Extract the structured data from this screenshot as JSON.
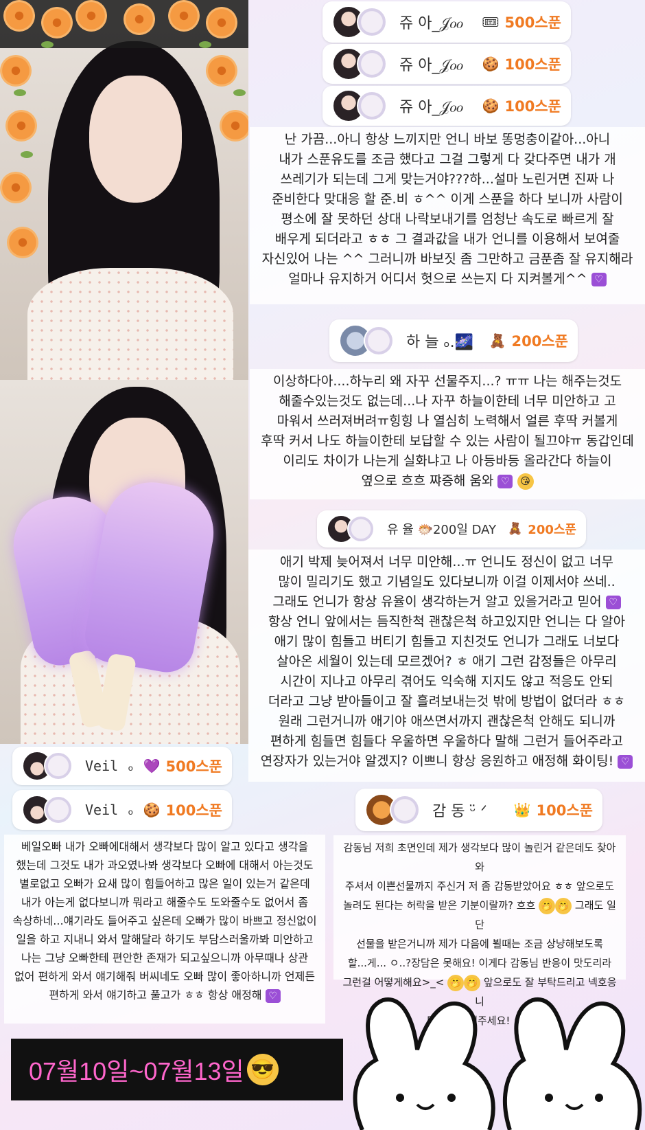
{
  "donations": [
    {
      "name": "쥬 아_𝒥𝑜𝑜",
      "gift_icon": "ticket-icon",
      "amount": "500스푼"
    },
    {
      "name": "쥬 아_𝒥𝑜𝑜",
      "gift_icon": "cookie-icon",
      "amount": "100스푼"
    },
    {
      "name": "쥬 아_𝒥𝑜𝑜",
      "gift_icon": "cookie-icon",
      "amount": "100스푼"
    },
    {
      "name": "하 늘 ₒ.🌌",
      "gift_icon": "bear-icon",
      "amount": "200스푼"
    },
    {
      "name": "유 율 🐡200일 DAY",
      "gift_icon": "bear-icon",
      "amount": "200스푼"
    },
    {
      "name": "Veil ₒ",
      "gift_icon": "heart-icon",
      "amount": "500스푼"
    },
    {
      "name": "Veil ₒ",
      "gift_icon": "cookie-icon",
      "amount": "100스푼"
    },
    {
      "name": "감 동 ᵕ̈ ᐟ",
      "gift_icon": "crown-icon",
      "amount": "100스푼"
    }
  ],
  "messages": {
    "juah": {
      "lines": [
        "난 가끔...아니 항상 느끼지만 언니 바보 똥멍충이같아...아니",
        "내가 스푼유도를 조금 했다고 그걸 그렇게 다 갖다주면 내가 개",
        "쓰레기가 되는데 그게 맞는거야???하...설마 노린거면 진짜 나",
        "준비한다 맞대응 할 준.비 ㅎ^^ 이게 스푼을 하다 보니까 사람이",
        "평소에 잘 못하던 상대 나락보내기를 엄청난 속도로 빠르게 잘",
        "배우게 되더라고 ㅎㅎ 그 결과값을 내가 언니를 이용해서 보여줄",
        "자신있어 나는 ^^ 그러니까 바보짓 좀 그만하고 금푼좀 잘 유지해라"
      ],
      "last": "얼마나 유지하거 어디서 헛으로 쓰는지 다 지켜볼게^^"
    },
    "haneul": {
      "lines": [
        "이상하다아....하누리 왜 자꾸 선물주지...? ㅠㅠ 나는 해주는것도",
        "해줄수있는것도 없는데...나 자꾸 하늘이한테 너무 미안하고 고",
        "마워서 쓰러져버려ㅠ힝힝 나 열심히 노력해서 얼른 후딱 커볼게",
        "후딱 커서 나도 하늘이한테 보답할 수 있는 사람이 될끄야ㅠ 동갑인데",
        "이리도 차이가 나는게 실화냐고 나 아등바등 올라간다 하늘이"
      ],
      "last": "옆으로 흐흐 쨔증해 움와"
    },
    "yuyul": {
      "lines": [
        "애기 박제 늦어져서 너무 미안해...ㅠ 언니도 정신이 없고 너무",
        "많이 밀리기도 했고 기념일도 있다보니까 이걸 이제서야 쓰네..",
        "그래도 언니가 항상 유율이 생각하는거 알고 있을거라고 믿어",
        "항상 언니 앞에서는 듬직한척 괜찮은척 하고있지만 언니는 다 알아",
        "애기 많이 힘들고 버티기 힘들고 지친것도 언니가 그래도 너보다",
        "살아온 세월이 있는데 모르겠어? ㅎ 애기 그런 감정들은 아무리",
        "시간이 지나고 아무리 겪어도 익숙해 지지도 않고 적응도 안되",
        "더라고 그냥 받아들이고 잘 흘려보내는것 밖에 방법이 없더라 ㅎㅎ",
        "원래 그런거니까 애기야 애쓰면서까지 괜찮은척 안해도 되니까",
        "편하게 힘들면 힘들다 우울하면 우울하다 말해 그런거 들어주라고"
      ],
      "last": "연장자가 있는거야 알겠지? 이쁘니 항상 응원하고 애정해 화이팅!"
    },
    "veil": {
      "lines": [
        "베일오빠 내가 오빠에대해서 생각보다 많이 알고 있다고 생각을",
        "했는데 그것도 내가 과오였나봐 생각보다 오빠에 대해서 아는것도",
        "별로없고 오빠가 요새 많이 힘들어하고 많은 일이 있는거 같은데",
        "내가 아는게 없다보니까 뭐라고 해줄수도 도와줄수도 없어서 좀",
        "속상하네...얘기라도 들어주고 싶은데 오빠가 많이 바쁘고 정신없이",
        "일을 하고 지내니 와서 말해달라 하기도 부담스러울까봐 미안하고",
        "나는 그냥 오빠한테 편안한 존재가 되고싶으니까 아무때나 상관",
        "없어 편하게 와서 얘기해줘 버씨네도 오빠 많이 좋아하니까 언제든"
      ],
      "last": "편하게 와서 얘기하고 풀고가 ㅎㅎ 항상 애정해"
    },
    "gamdong": {
      "lines": [
        "감동님 저희 초면인데 제가 생각보다 많이 놀린거 같은데도 찾아와",
        "주셔서 이쁜선물까지 주신거 저 좀 감동받았어요 ㅎㅎ 앞으로도",
        "놀려도 된다는 허락을 받은 기분이랄까? 흐흐",
        "선물을 받은거니까 제가 다음에 뵐때는 조금 상냥해보도록",
        "할...게... ㅇ..?장담은 못해요! 이게다 감동님 반응이 맛도리라",
        "그런걸 어떻게해요>_<",
        "많이 이뻐해주세요! ㅎㅎ"
      ],
      "inline_a": "그래도 일단",
      "inline_b": "앞으로도 잘 부탁드리고 넥호응니"
    }
  },
  "footer": {
    "date_range": "07월10일~07월13일"
  },
  "colors": {
    "accent": "#f07a22",
    "heart": "#9b4fd6",
    "date_text": "#ff66cc"
  }
}
